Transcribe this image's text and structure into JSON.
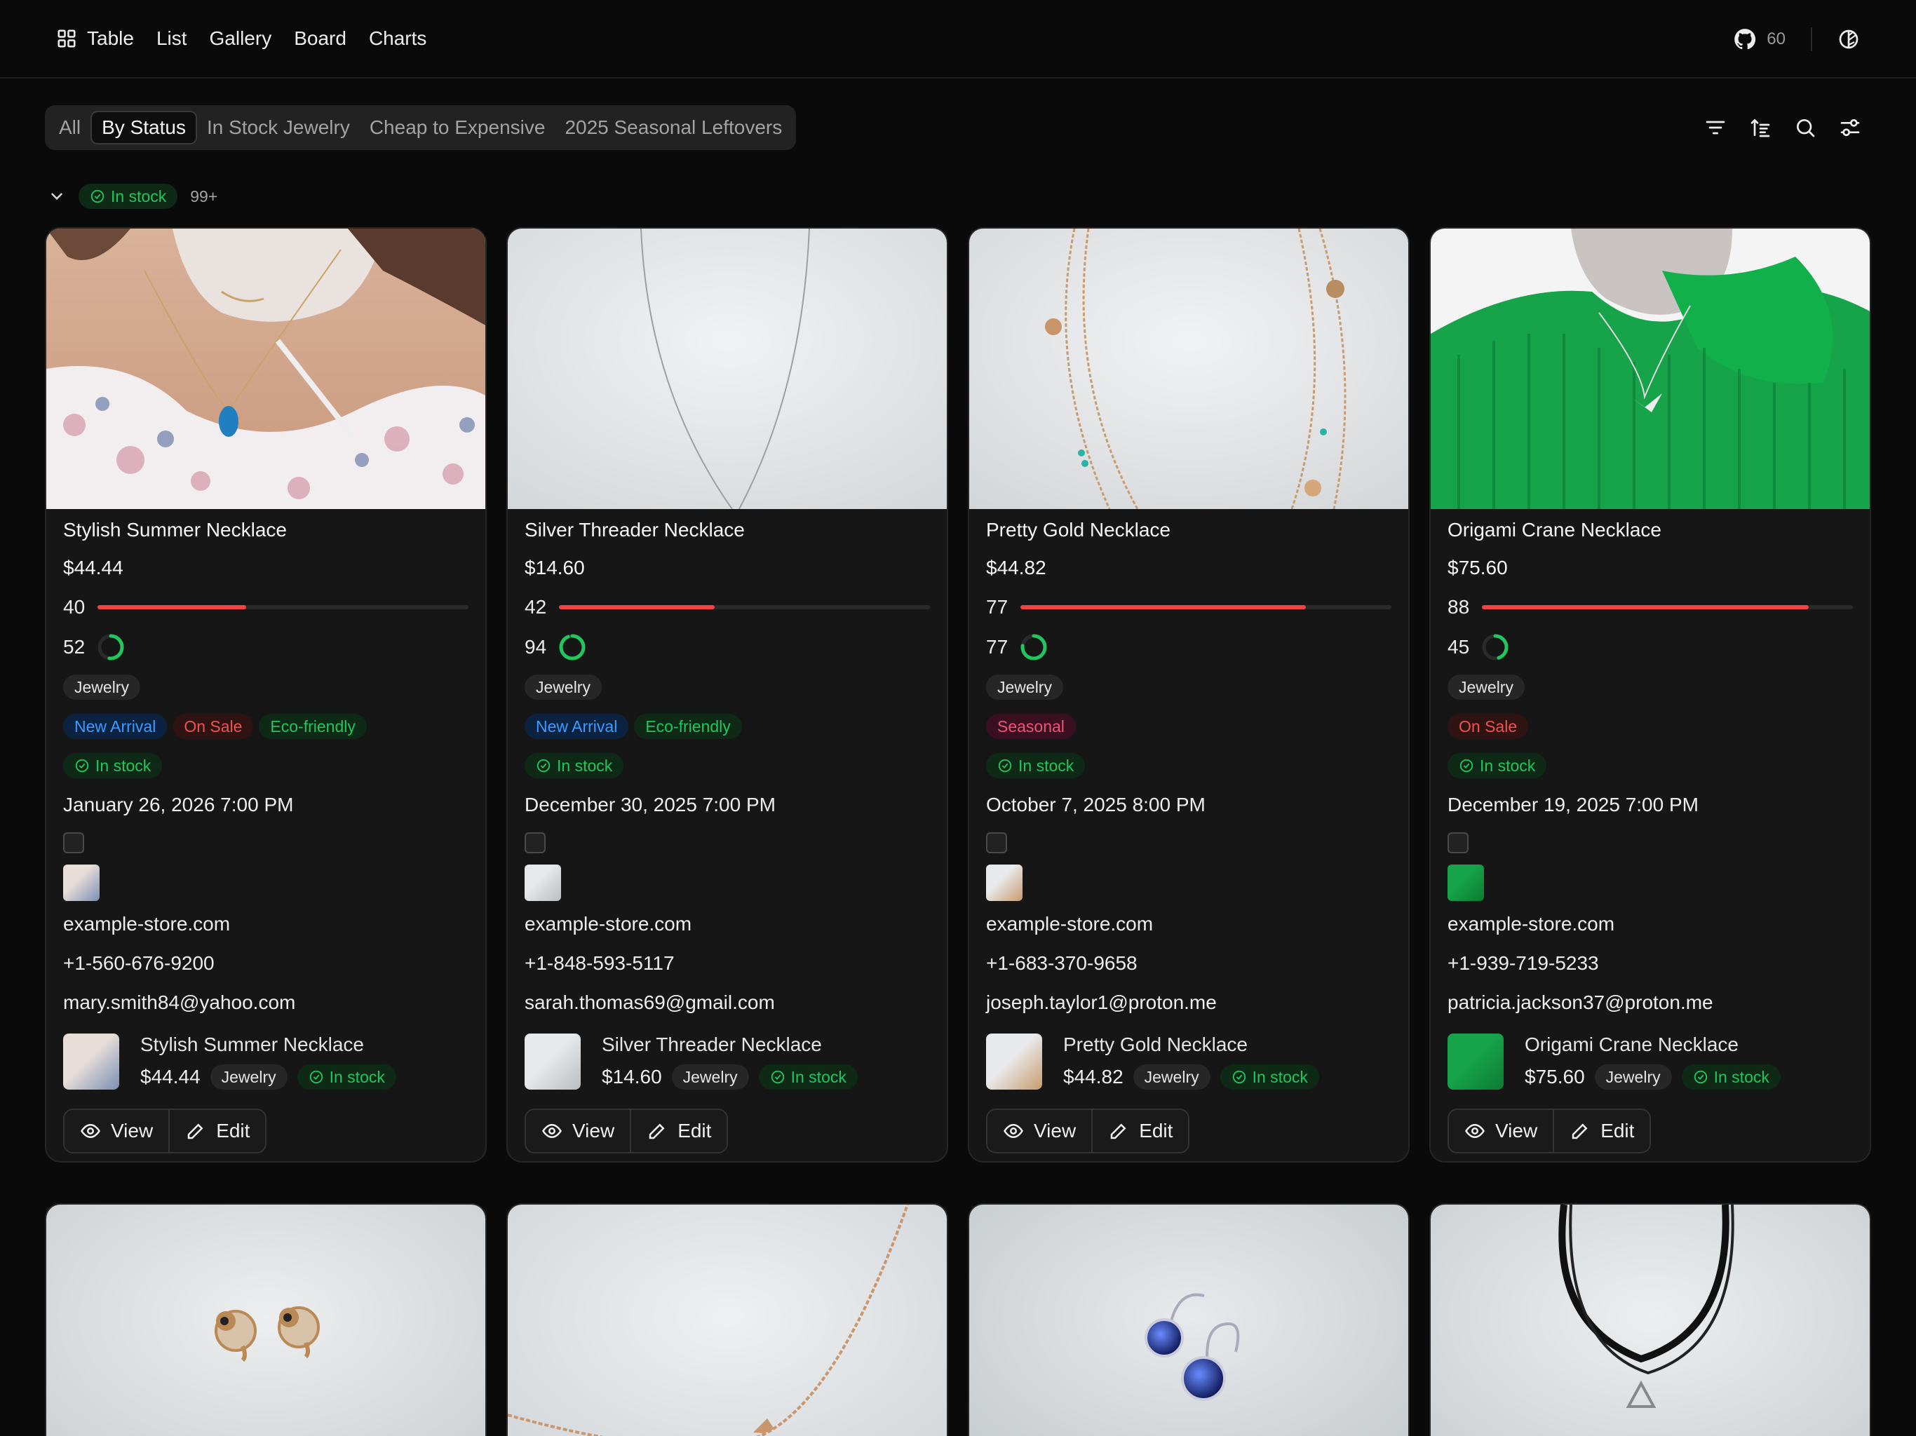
{
  "nav": {
    "items": [
      {
        "label": "Table",
        "icon": "grid-icon"
      },
      {
        "label": "List"
      },
      {
        "label": "Gallery"
      },
      {
        "label": "Board"
      },
      {
        "label": "Charts"
      }
    ],
    "github_count": "60"
  },
  "views": {
    "tabs": [
      "All",
      "By Status",
      "In Stock Jewelry",
      "Cheap to Expensive",
      "2025 Seasonal Leftovers"
    ],
    "active": "By Status"
  },
  "group": {
    "status": "In stock",
    "count": "99+"
  },
  "colors": {
    "accent_green": "#22c55e",
    "progress_red": "#ef4444",
    "background": "#0a0a0a"
  },
  "cards": [
    {
      "title": "Stylish Summer Necklace",
      "price": "$44.44",
      "progress": {
        "label": "40",
        "value": 40
      },
      "ring": {
        "label": "52",
        "value": 52
      },
      "category": "Jewelry",
      "tags": [
        {
          "label": "New Arrival",
          "kind": "blue"
        },
        {
          "label": "On Sale",
          "kind": "red"
        },
        {
          "label": "Eco-friendly",
          "kind": "green"
        }
      ],
      "status": "In stock",
      "date": "January 26, 2026 7:00 PM",
      "url": "example-store.com",
      "phone": "+1-560-676-9200",
      "email": "mary.smith84@yahoo.com",
      "view_label": "View",
      "edit_label": "Edit"
    },
    {
      "title": "Silver Threader Necklace",
      "price": "$14.60",
      "progress": {
        "label": "42",
        "value": 42
      },
      "ring": {
        "label": "94",
        "value": 94
      },
      "category": "Jewelry",
      "tags": [
        {
          "label": "New Arrival",
          "kind": "blue"
        },
        {
          "label": "Eco-friendly",
          "kind": "green"
        }
      ],
      "status": "In stock",
      "date": "December 30, 2025 7:00 PM",
      "url": "example-store.com",
      "phone": "+1-848-593-5117",
      "email": "sarah.thomas69@gmail.com",
      "view_label": "View",
      "edit_label": "Edit"
    },
    {
      "title": "Pretty Gold Necklace",
      "price": "$44.82",
      "progress": {
        "label": "77",
        "value": 77
      },
      "ring": {
        "label": "77",
        "value": 77
      },
      "category": "Jewelry",
      "tags": [
        {
          "label": "Seasonal",
          "kind": "pink"
        }
      ],
      "status": "In stock",
      "date": "October 7, 2025 8:00 PM",
      "url": "example-store.com",
      "phone": "+1-683-370-9658",
      "email": "joseph.taylor1@proton.me",
      "view_label": "View",
      "edit_label": "Edit"
    },
    {
      "title": "Origami Crane Necklace",
      "price": "$75.60",
      "progress": {
        "label": "88",
        "value": 88
      },
      "ring": {
        "label": "45",
        "value": 45
      },
      "category": "Jewelry",
      "tags": [
        {
          "label": "On Sale",
          "kind": "red"
        }
      ],
      "status": "In stock",
      "date": "December 19, 2025 7:00 PM",
      "url": "example-store.com",
      "phone": "+1-939-719-5233",
      "email": "patricia.jackson37@proton.me",
      "view_label": "View",
      "edit_label": "Edit"
    }
  ]
}
